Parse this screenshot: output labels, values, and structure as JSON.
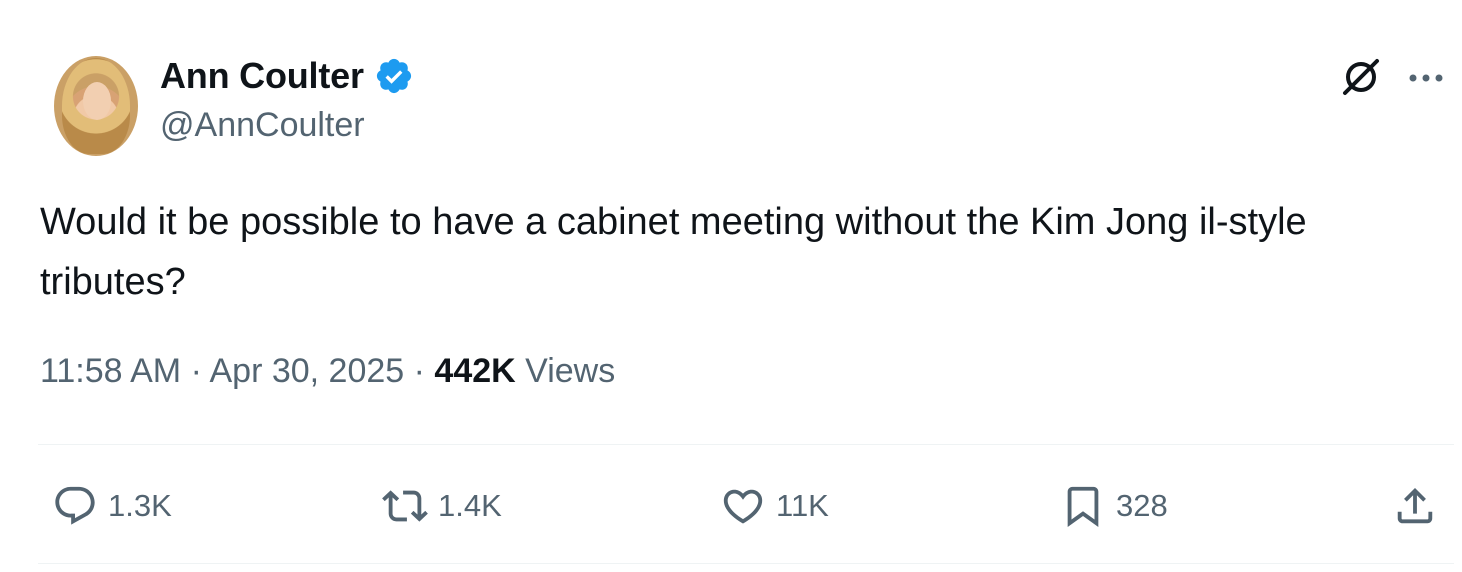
{
  "author": {
    "display_name": "Ann Coulter",
    "handle": "@AnnCoulter",
    "verified": true
  },
  "tweet": {
    "text": "Would it be possible to have a cabinet meeting without the Kim Jong il-style tributes?",
    "time": "11:58 AM",
    "date": "Apr 30, 2025",
    "separator": " · ",
    "views_count": "442K",
    "views_label": "Views"
  },
  "engagement": {
    "replies": "1.3K",
    "reposts": "1.4K",
    "likes": "11K",
    "bookmarks": "328"
  },
  "icons": {
    "verified": "verified-badge-icon",
    "grok": "grok-icon",
    "more": "more-icon",
    "reply": "reply-icon",
    "repost": "repost-icon",
    "like": "heart-icon",
    "bookmark": "bookmark-icon",
    "share": "share-icon"
  },
  "colors": {
    "verified_blue": "#1d9bf0",
    "secondary_text": "#536471",
    "primary_text": "#0f1419",
    "divider": "#eff3f4"
  }
}
